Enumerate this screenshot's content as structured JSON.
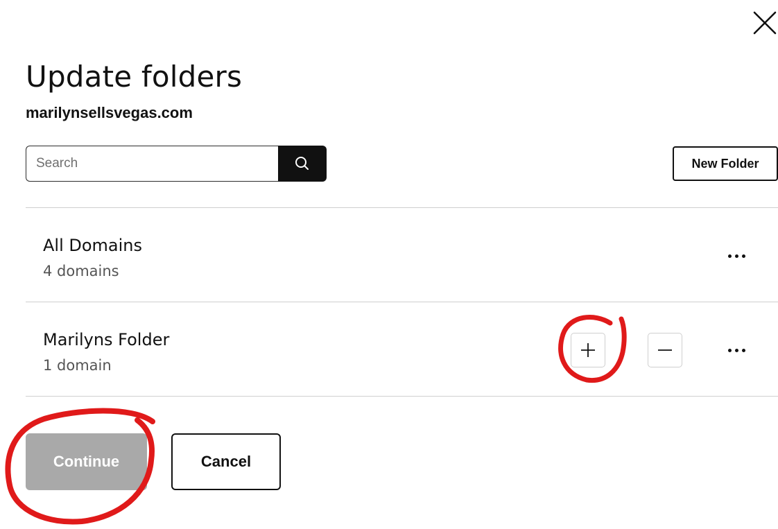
{
  "dialog": {
    "title": "Update folders",
    "domain": "marilynsellsvegas.com",
    "close_icon": "close-icon"
  },
  "search": {
    "placeholder": "Search",
    "value": "",
    "icon": "search-icon"
  },
  "toolbar": {
    "new_folder_label": "New Folder"
  },
  "folders": [
    {
      "name": "All Domains",
      "count": "4 domains",
      "actions": [
        "more-icon"
      ]
    },
    {
      "name": "Marilyns Folder",
      "count": "1 domain",
      "actions": [
        "plus-icon",
        "minus-icon",
        "more-icon"
      ]
    }
  ],
  "footer": {
    "continue_label": "Continue",
    "cancel_label": "Cancel"
  },
  "colors": {
    "text": "#111111",
    "muted_text": "#555555",
    "divider": "#cfcfcf",
    "disabled_button": "#a9a9a9",
    "search_button": "#111111",
    "annotation_red": "#e01a1a"
  }
}
